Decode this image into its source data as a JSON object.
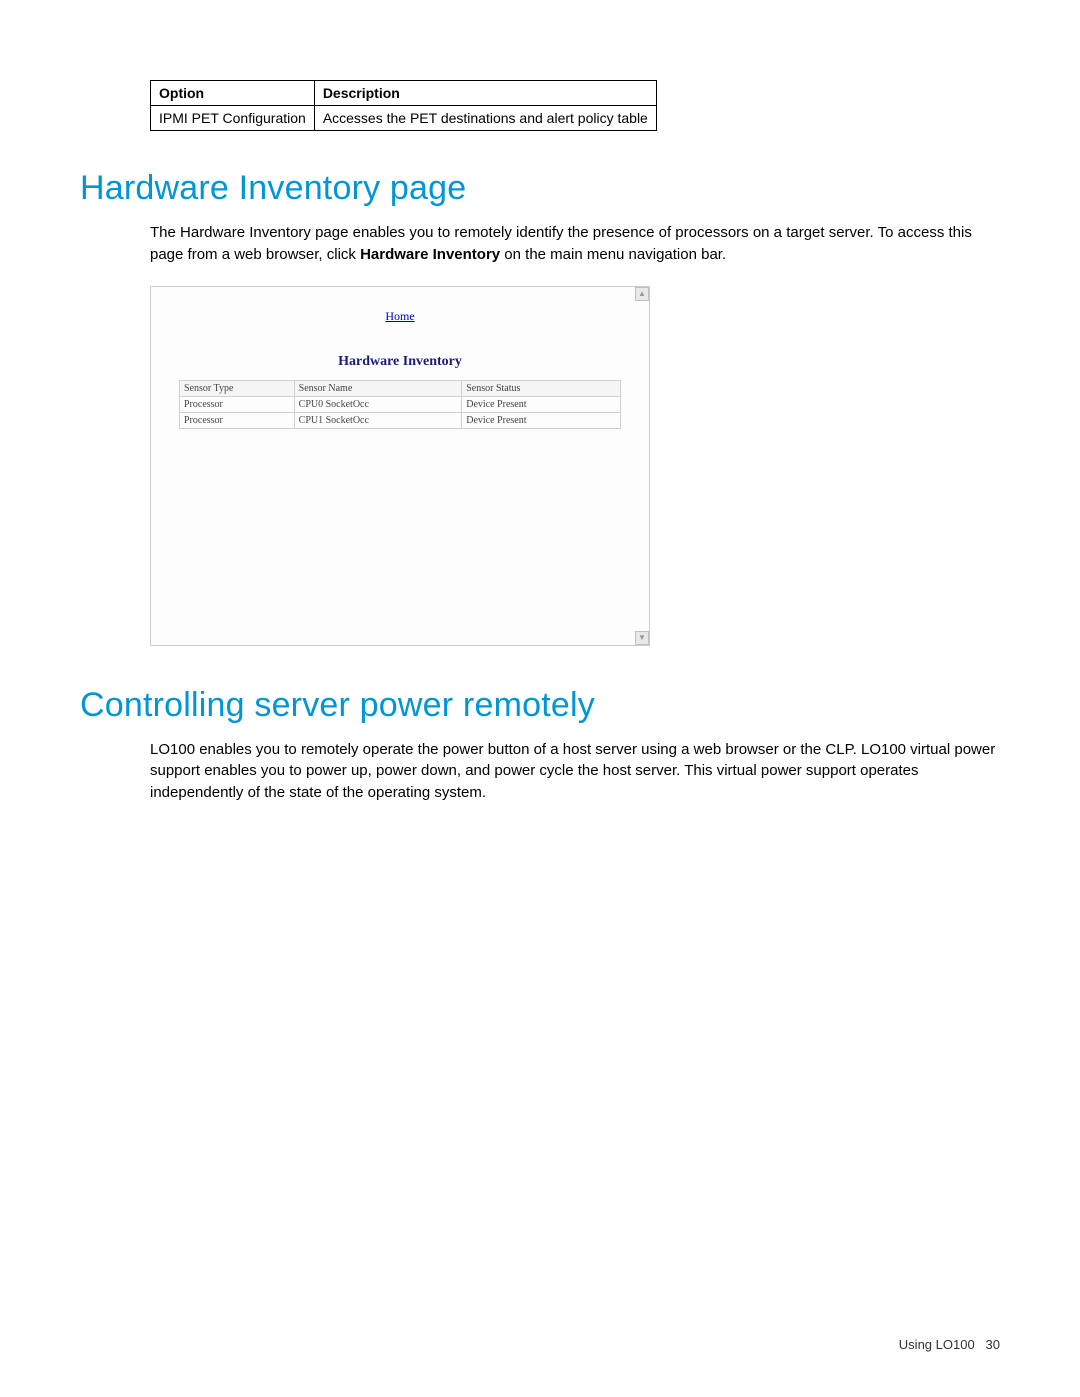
{
  "optionTable": {
    "headers": {
      "col1": "Option",
      "col2": "Description"
    },
    "row": {
      "col1": "IPMI PET Configuration",
      "col2": "Accesses the PET destinations and alert policy table"
    }
  },
  "section1": {
    "heading": "Hardware Inventory page",
    "body_pre": "The Hardware Inventory page enables you to remotely identify the presence of processors on a target server. To access this page from a web browser, click ",
    "body_bold": "Hardware Inventory",
    "body_post": " on the main menu navigation bar."
  },
  "screenshot": {
    "home": "Home",
    "title": "Hardware Inventory",
    "headers": {
      "c1": "Sensor Type",
      "c2": "Sensor Name",
      "c3": "Sensor Status"
    },
    "rows": [
      {
        "c1": "Processor",
        "c2": "CPU0 SocketOcc",
        "c3": "Device Present"
      },
      {
        "c1": "Processor",
        "c2": "CPU1 SocketOcc",
        "c3": "Device Present"
      }
    ]
  },
  "section2": {
    "heading": "Controlling server power remotely",
    "body": "LO100 enables you to remotely operate the power button of a host server using a web browser or the CLP. LO100 virtual power support enables you to power up, power down, and power cycle the host server. This virtual power support operates independently of the state of the operating system."
  },
  "footer": {
    "label": "Using LO100",
    "page": "30"
  }
}
